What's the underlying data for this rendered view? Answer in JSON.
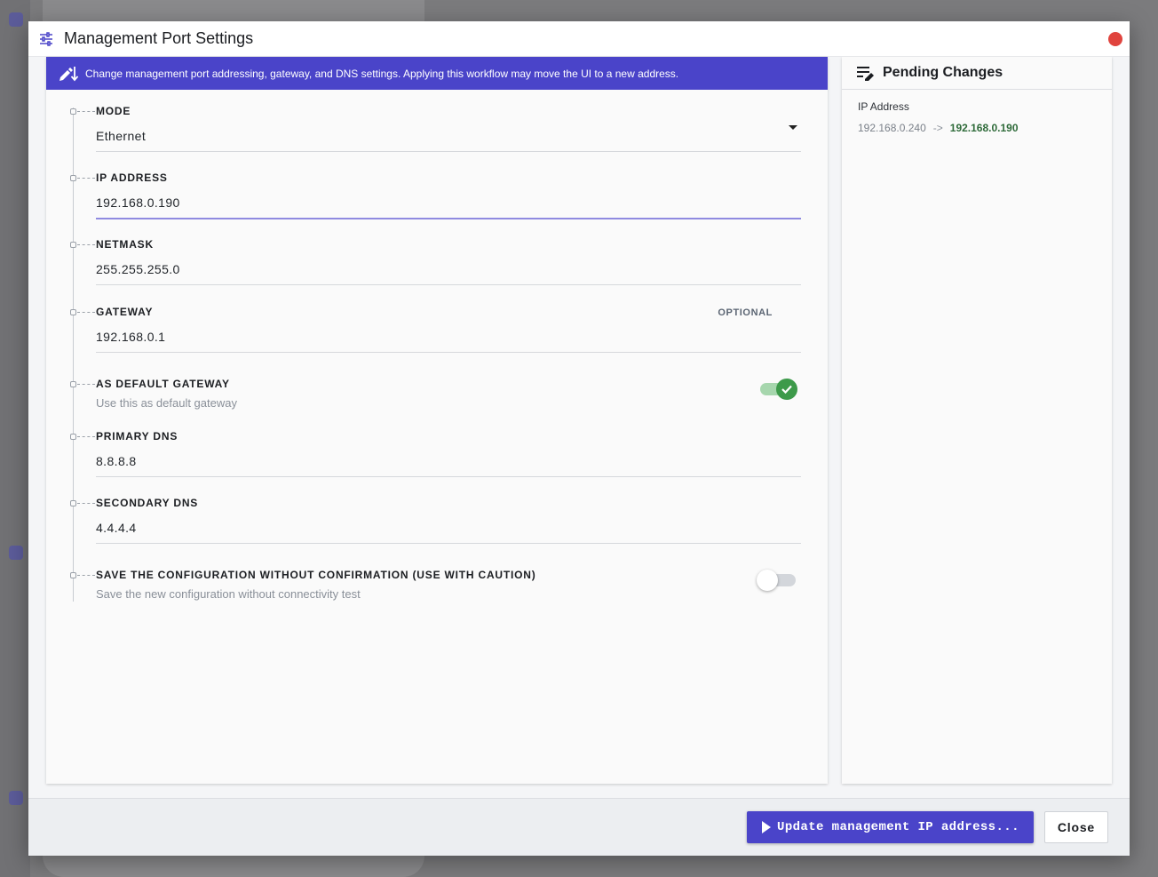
{
  "dialog": {
    "title": "Management Port Settings",
    "icon": "tune-icon"
  },
  "banner": {
    "icon": "edit-arrow-icon",
    "text": "Change management port addressing, gateway, and DNS settings. Applying this workflow may move the UI to a new address."
  },
  "form": {
    "mode": {
      "label": "MODE",
      "value": "Ethernet"
    },
    "ip_address": {
      "label": "IP ADDRESS",
      "value": "192.168.0.190"
    },
    "netmask": {
      "label": "NETMASK",
      "value": "255.255.255.0"
    },
    "gateway": {
      "label": "GATEWAY",
      "optional": "OPTIONAL",
      "value": "192.168.0.1"
    },
    "default_gateway": {
      "label": "AS DEFAULT GATEWAY",
      "description": "Use this as default gateway",
      "enabled": true
    },
    "primary_dns": {
      "label": "PRIMARY DNS",
      "value": "8.8.8.8"
    },
    "secondary_dns": {
      "label": "SECONDARY DNS",
      "value": "4.4.4.4"
    },
    "save_without_confirmation": {
      "label": "SAVE THE CONFIGURATION WITHOUT CONFIRMATION (USE WITH CAUTION)",
      "description": "Save the new configuration without connectivity test",
      "enabled": false
    }
  },
  "pending": {
    "title": "Pending Changes",
    "icon": "pending-edit-icon",
    "changes": [
      {
        "name": "IP Address",
        "old": "192.168.0.240",
        "arrow": "->",
        "new": "192.168.0.190"
      }
    ]
  },
  "footer": {
    "update_label": "Update management IP address...",
    "close_label": "Close"
  },
  "colors": {
    "accent": "#4a44c9",
    "toggle_on": "#3d9a4a",
    "new_value": "#2f6b3a",
    "close_dot": "#e0443e"
  }
}
